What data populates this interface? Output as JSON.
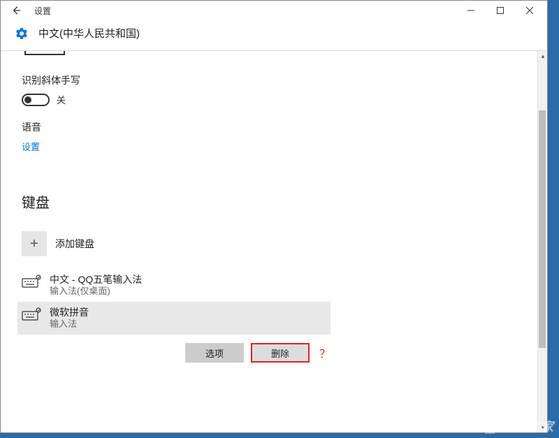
{
  "window": {
    "title": "设置",
    "subtitle": "中文(中华人民共和国)"
  },
  "handwriting": {
    "label": "识别斜体手写",
    "state": "关"
  },
  "voice": {
    "label": "语音",
    "link": "设置"
  },
  "keyboard": {
    "heading": "键盘",
    "add_label": "添加键盘",
    "items": [
      {
        "name": "中文 - QQ五笔输入法",
        "sub": "输入法(仅桌面)"
      },
      {
        "name": "微软拼音",
        "sub": "输入法"
      }
    ],
    "options_btn": "选项",
    "remove_btn": "删除"
  },
  "annotation": "？",
  "watermark": "系统之家"
}
